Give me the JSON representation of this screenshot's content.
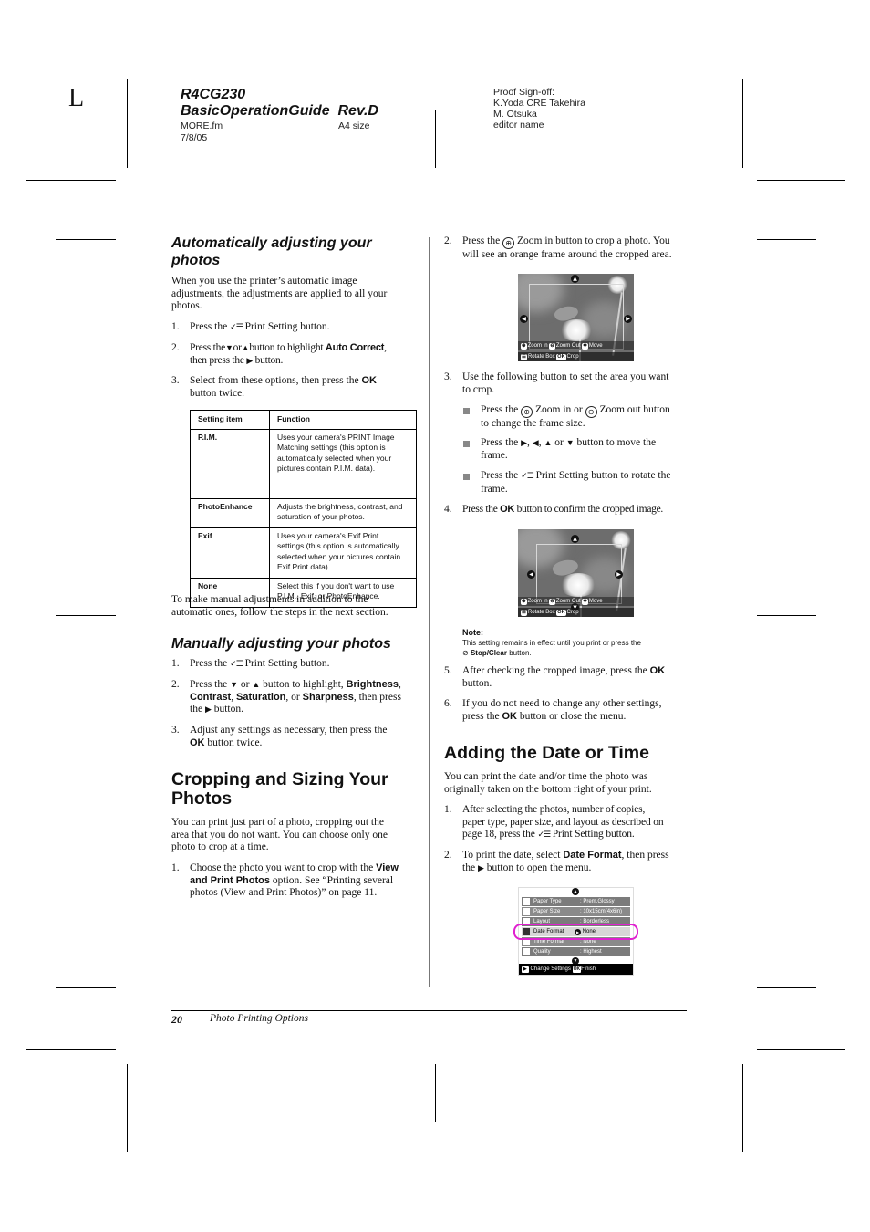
{
  "header": {
    "crop_letter": "L",
    "title_line1": "R4CG230",
    "title_line2": "BasicOperationGuide  Rev.D",
    "file": "MORE.fm",
    "date": "7/8/05",
    "size": "A4 size",
    "proof_lines": [
      "Proof Sign-off:",
      "K.Yoda CRE Takehira",
      "M. Otsuka",
      "editor name"
    ]
  },
  "left": {
    "auto_heading_l1": "Automatically adjusting your",
    "auto_heading_l2": "photos",
    "auto_intro": [
      "When you use the printer’s automatic image",
      "adjustments, the adjustments are applied to all your",
      "photos."
    ],
    "auto_steps": [
      {
        "num": "1.",
        "pre": "Press the",
        "icon": "print-setting",
        "post": "Print Setting button."
      },
      {
        "num": "2.",
        "line1_pre": "Press the",
        "line1_mid1": "or",
        "line1_mid2": "button to highlight",
        "bold": "Auto Correct",
        "line1_post": ",",
        "line2_pre": "then press the",
        "line2_post": "button."
      },
      {
        "num": "3.",
        "line1_pre": "Select from these options, then press the",
        "bold": "OK",
        "line2": "button twice."
      }
    ],
    "table": {
      "headers": [
        "Setting item",
        "Function"
      ],
      "rows": [
        {
          "item": "P.I.M.",
          "function": [
            "Uses your camera's PRINT Image",
            "Matching settings (this option is",
            "automatically selected when your",
            "pictures contain P.I.M. data)."
          ]
        },
        {
          "item": "PhotoEnhance",
          "function": [
            "Adjusts the brightness, contrast, and",
            "saturation of your photos."
          ]
        },
        {
          "item": "Exif",
          "function": [
            "Uses your camera's Exif Print",
            "settings (this option is automatically",
            "selected when your pictures contain",
            "Exif Print data)."
          ]
        },
        {
          "item": "None",
          "function": [
            "Select this if you don't want to use",
            "P.I.M., Exif, or PhotoEnhance."
          ]
        }
      ]
    },
    "manual_note": [
      "To make manual adjustments in addition to the",
      "automatic ones, follow the steps in the next section."
    ],
    "manual_heading": "Manually adjusting your photos",
    "manual_steps": [
      {
        "num": "1.",
        "pre": "Press the",
        "post": "Print Setting button."
      },
      {
        "num": "2.",
        "l1_pre": "Press the",
        "l1_or": "or",
        "l1_mid": "button to highlight,",
        "b1": "Brightness",
        "b2": "Contrast",
        "b3": "Saturation",
        "or2": ", or",
        "b4": "Sharpness",
        "l2_post": ", then press",
        "l3_pre": "the",
        "l3_post": "button."
      },
      {
        "num": "3.",
        "l1": "Adjust any settings as necessary, then press the",
        "bold": "OK",
        "l2_post": "button twice."
      }
    ],
    "crop_heading_l1": "Cropping and Sizing Your",
    "crop_heading_l2": "Photos",
    "crop_intro": [
      "You can print just part of a photo, cropping out the",
      "area that you do not want. You can choose only one",
      "photo to crop at a time."
    ],
    "crop_step1": {
      "num": "1.",
      "l1_pre": "Choose the photo you want to crop with the",
      "b1": "View",
      "b2": "and Print Photos",
      "l2_post": "option. See “Printing several",
      "l3": "photos (View and Print Photos)” on page 11."
    }
  },
  "right": {
    "step2": {
      "num": "2.",
      "pre": "Press the",
      "post": "Zoom in button to crop a photo. You",
      "l2": "will see an orange frame around the cropped area."
    },
    "lcd": {
      "zoom_in": "Zoom In",
      "zoom_out": "Zoom Out",
      "move": "Move",
      "rotate": "Rotate Box",
      "ok": "OK",
      "crop": "Crop"
    },
    "step3": {
      "num": "3.",
      "l1": "Use the following button to set the area you want",
      "l2": "to crop."
    },
    "bullets": [
      {
        "pre": "Press the",
        "mid": "Zoom in or",
        "post": "Zoom out button",
        "l2": "to change the frame size."
      },
      {
        "pre": "Press the",
        "sep1": ",",
        "sep2": ",",
        "or": "or",
        "post": "button to move the",
        "l2": "frame."
      },
      {
        "pre": "Press the",
        "post": "Print Setting button to rotate the",
        "l2": "frame."
      }
    ],
    "step4": {
      "num": "4.",
      "pre": "Press the",
      "bold": "OK",
      "post": "button to confirm the cropped image."
    },
    "note": {
      "title": "Note:",
      "l1": "This setting remains in effect until you print or press the",
      "bold": "Stop/Clear",
      "l2_post": "button."
    },
    "step5": {
      "num": "5.",
      "l1": "After checking the cropped image, press the",
      "bold": "OK",
      "l2": "button."
    },
    "step6": {
      "num": "6.",
      "l1": "If you do not need to change any other settings,",
      "l2_pre": "press the",
      "bold": "OK",
      "l2_post": "button or close the menu."
    },
    "date_heading": "Adding the Date or Time",
    "date_intro": [
      "You can print the date and/or time the photo was",
      "originally taken on the bottom right of your print."
    ],
    "date_step1": {
      "num": "1.",
      "l1": "After selecting the photos, number of copies,",
      "l2": "paper type, paper size, and layout as described on",
      "l3_pre": "page 18, press the",
      "l3_post": "Print Setting button."
    },
    "date_step2": {
      "num": "2.",
      "l1_pre": "To print the date, select",
      "bold": "Date Format",
      "l1_post": ", then press",
      "l2_pre": "the",
      "l2_post": "button to open the menu."
    },
    "menu": {
      "rows": [
        {
          "label": "Paper Type",
          "value": "Prem.Glossy"
        },
        {
          "label": "Paper Size",
          "value": "10x15cm(4x6in)"
        },
        {
          "label": "Layout",
          "value": "Borderless"
        },
        {
          "label": "Date Format",
          "value": "None",
          "selected": true
        },
        {
          "label": "Time Format",
          "value": "None"
        },
        {
          "label": "Quality",
          "value": "Highest"
        }
      ],
      "footer_change": "Change Settings",
      "footer_ok": "OK",
      "footer_finish": "Finish",
      "highlight_color": "#e020d0"
    }
  },
  "footer": {
    "page_number": "20",
    "section": "Photo Printing Options"
  }
}
